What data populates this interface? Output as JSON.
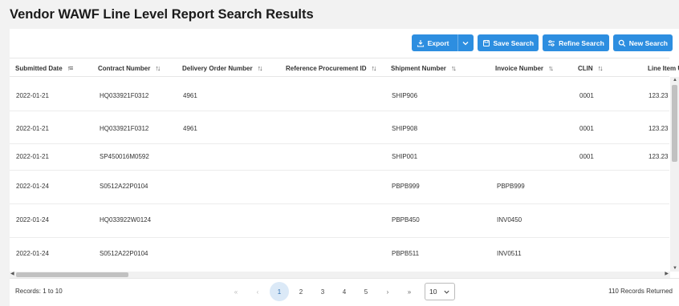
{
  "page": {
    "title": "Vendor WAWF Line Level Report Search Results"
  },
  "toolbar": {
    "export_label": "Export",
    "save_label": "Save Search",
    "refine_label": "Refine Search",
    "new_label": "New Search",
    "accent": "#2d8ee0"
  },
  "table": {
    "columns": [
      "Submitted Date",
      "Contract Number",
      "Delivery Order Number",
      "Reference Procurement ID",
      "Shipment Number",
      "Invoice Number",
      "CLIN",
      "Line Item U"
    ],
    "rows": [
      {
        "date": "2022-01-21",
        "contract": "HQ033921F0312",
        "delivery": "4961",
        "ref": "",
        "shipment": "SHIP906",
        "invoice": "",
        "clin": "0001",
        "line": "123.23"
      },
      {
        "date": "2022-01-21",
        "contract": "HQ033921F0312",
        "delivery": "4961",
        "ref": "",
        "shipment": "SHIP908",
        "invoice": "",
        "clin": "0001",
        "line": "123.23"
      },
      {
        "date": "2022-01-21",
        "contract": "SP450016M0592",
        "delivery": "",
        "ref": "",
        "shipment": "SHIP001",
        "invoice": "",
        "clin": "0001",
        "line": "123.23"
      },
      {
        "date": "2022-01-24",
        "contract": "S0512A22P0104",
        "delivery": "",
        "ref": "",
        "shipment": "PBPB999",
        "invoice": "PBPB999",
        "clin": "",
        "line": ""
      },
      {
        "date": "2022-01-24",
        "contract": "HQ033922W0124",
        "delivery": "",
        "ref": "",
        "shipment": "PBPB450",
        "invoice": "INV0450",
        "clin": "",
        "line": ""
      },
      {
        "date": "2022-01-24",
        "contract": "S0512A22P0104",
        "delivery": "",
        "ref": "",
        "shipment": "PBPB511",
        "invoice": "INV0511",
        "clin": "",
        "line": ""
      }
    ]
  },
  "footer": {
    "records_range": "Records: 1 to 10",
    "records_total": "110 Records Returned",
    "pages": [
      "1",
      "2",
      "3",
      "4",
      "5"
    ],
    "current_page": "1",
    "first": "«",
    "prev": "‹",
    "next": "›",
    "last": "»",
    "page_size": "10"
  }
}
